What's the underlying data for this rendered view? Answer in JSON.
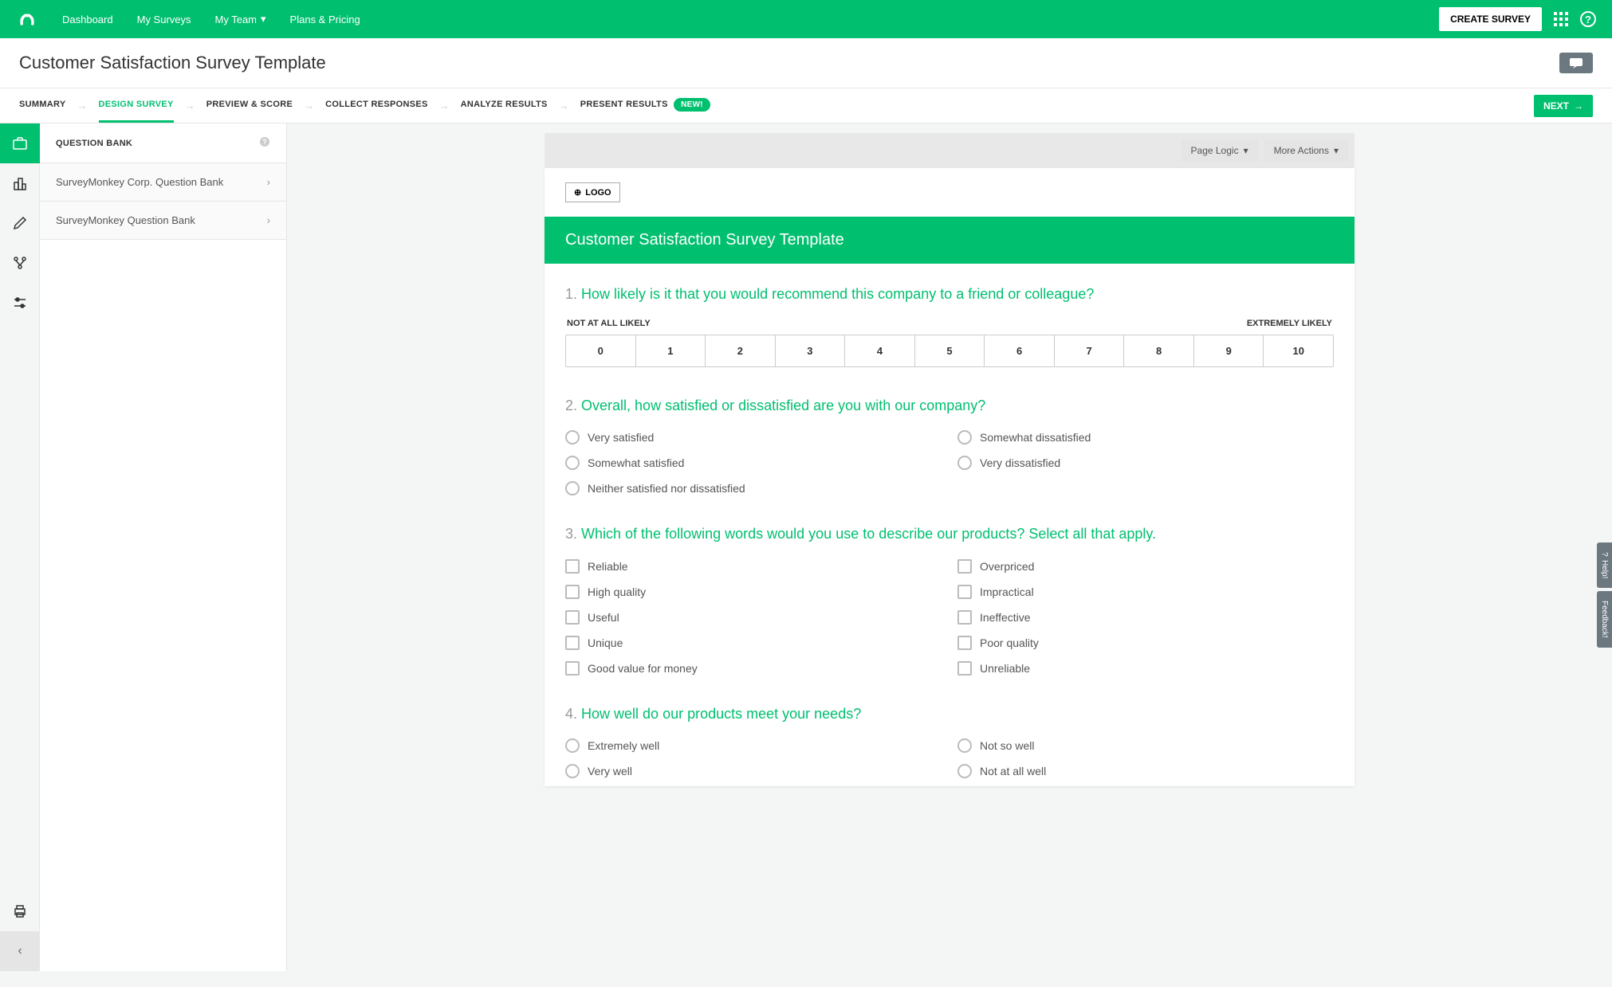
{
  "nav": {
    "dashboard": "Dashboard",
    "mySurveys": "My Surveys",
    "myTeam": "My Team",
    "plans": "Plans & Pricing",
    "createSurvey": "CREATE SURVEY"
  },
  "pageTitle": "Customer Satisfaction Survey Template",
  "steps": {
    "summary": "SUMMARY",
    "design": "DESIGN SURVEY",
    "preview": "PREVIEW & SCORE",
    "collect": "COLLECT RESPONSES",
    "analyze": "ANALYZE RESULTS",
    "present": "PRESENT RESULTS",
    "newBadge": "NEW!",
    "next": "NEXT"
  },
  "sidebar": {
    "header": "QUESTION BANK",
    "items": [
      "SurveyMonkey Corp. Question Bank",
      "SurveyMonkey Question Bank"
    ]
  },
  "pageActions": {
    "pageLogic": "Page Logic",
    "moreActions": "More Actions"
  },
  "logoBtn": "LOGO",
  "surveyTitle": "Customer Satisfaction Survey Template",
  "q1": {
    "num": "1.",
    "text": "How likely is it that you would recommend this company to a friend or colleague?",
    "leftLabel": "NOT AT ALL LIKELY",
    "rightLabel": "EXTREMELY LIKELY",
    "scale": [
      "0",
      "1",
      "2",
      "3",
      "4",
      "5",
      "6",
      "7",
      "8",
      "9",
      "10"
    ]
  },
  "q2": {
    "num": "2.",
    "text": "Overall, how satisfied or dissatisfied are you with our company?",
    "options": [
      "Very satisfied",
      "Somewhat dissatisfied",
      "Somewhat satisfied",
      "Very dissatisfied",
      "Neither satisfied nor dissatisfied"
    ]
  },
  "q3": {
    "num": "3.",
    "text": "Which of the following words would you use to describe our products? Select all that apply.",
    "options": [
      "Reliable",
      "Overpriced",
      "High quality",
      "Impractical",
      "Useful",
      "Ineffective",
      "Unique",
      "Poor quality",
      "Good value for money",
      "Unreliable"
    ]
  },
  "q4": {
    "num": "4.",
    "text": "How well do our products meet your needs?",
    "options": [
      "Extremely well",
      "Not so well",
      "Very well",
      "Not at all well"
    ]
  },
  "feedback": {
    "help": "Help!",
    "feedback": "Feedback!"
  }
}
